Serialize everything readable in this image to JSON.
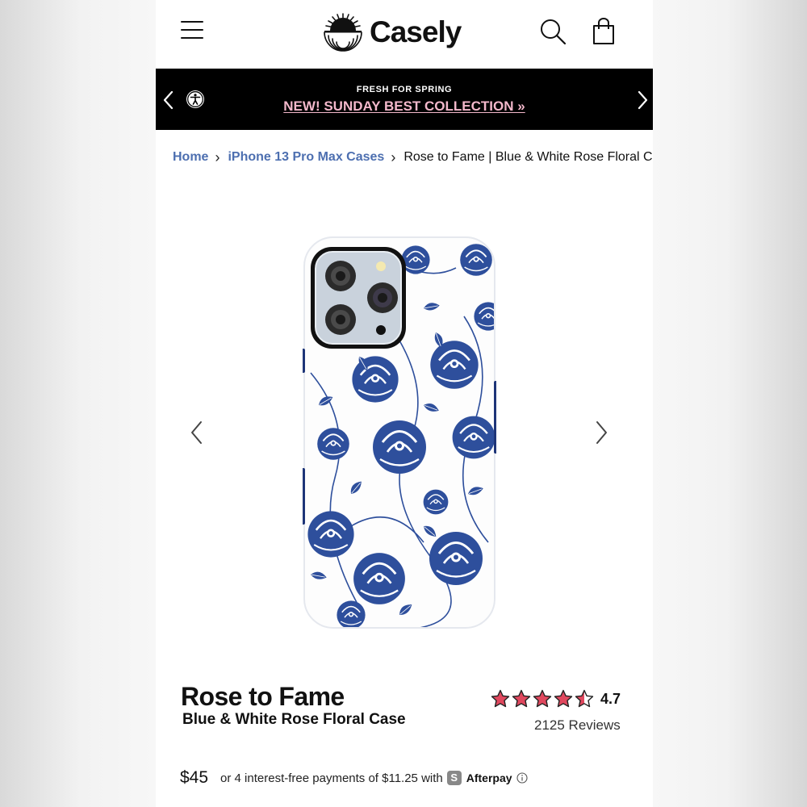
{
  "header": {
    "brand": "Casely",
    "icons": {
      "menu": "hamburger-menu-icon",
      "search": "search-icon",
      "cart": "shopping-bag-icon",
      "logo": "sunburst-logo-icon"
    }
  },
  "promo": {
    "kicker": "FRESH FOR SPRING",
    "link_label": "NEW! SUNDAY BEST COLLECTION »",
    "link_color": "#f3b8cb",
    "background": "#000000"
  },
  "breadcrumb": {
    "items": [
      "Home",
      "iPhone 13 Pro Max Cases"
    ],
    "current": "Rose to Fame | Blue & White Rose Floral Case"
  },
  "product": {
    "name": "Rose to Fame",
    "subtitle": "Blue & White Rose Floral Case",
    "rating": "4.7",
    "reviews": "2125 Reviews",
    "price": "$45",
    "installment_text": "or 4 interest-free payments of $11.25 with",
    "payment_provider": "Afterpay",
    "image_colors": {
      "print": "#2e4f9c",
      "base": "#ffffff"
    }
  },
  "colors": {
    "link": "#4d6fb0",
    "star": "#e0485e"
  }
}
